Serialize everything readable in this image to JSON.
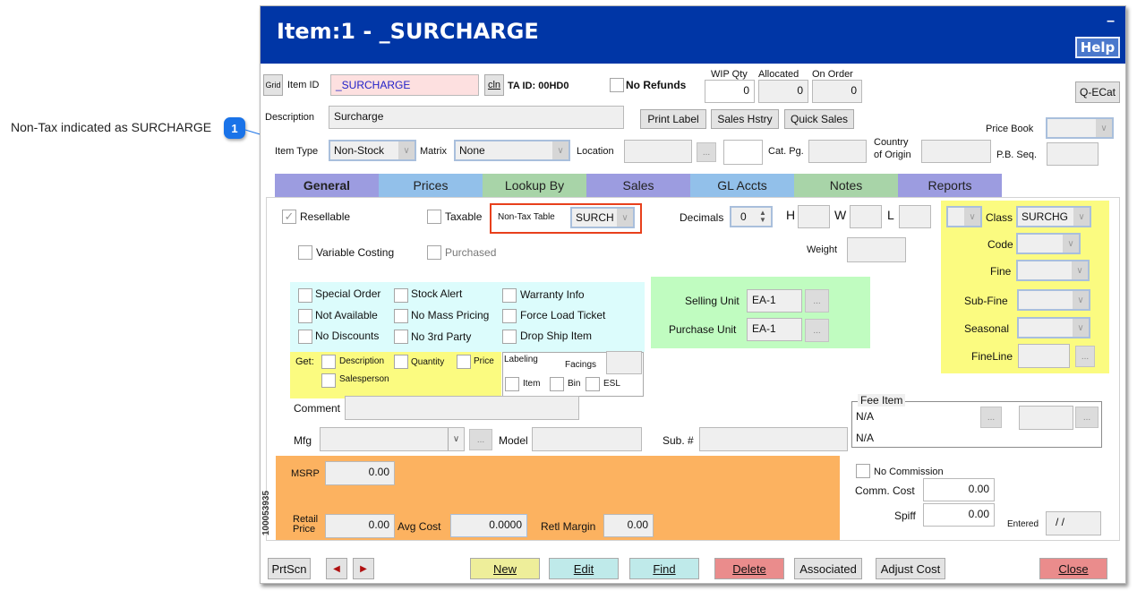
{
  "annotation": {
    "number": "1",
    "text": "Non-Tax indicated as SURCHARGE"
  },
  "window": {
    "title": "Item:1 - _SURCHARGE",
    "minimize": "–",
    "help_label": "Help"
  },
  "header": {
    "grid_label": "Grid",
    "item_id_label": "Item ID",
    "item_id_value": "_SURCHARGE",
    "cln_label": "cln",
    "ta_id": "TA ID: 00HD0",
    "no_refunds_label": "No Refunds",
    "no_refunds_checked": false,
    "wip_qty_label": "WIP Qty",
    "wip_qty_value": "0",
    "allocated_label": "Allocated",
    "allocated_value": "0",
    "on_order_label": "On Order",
    "on_order_value": "0",
    "qecat_label": "Q-ECat",
    "description_label": "Description",
    "description_value": "Surcharge",
    "print_label_btn": "Print Label",
    "sales_history_btn": "Sales Hstry",
    "quick_sales_btn": "Quick Sales",
    "price_book_label": "Price Book",
    "price_book_value": "",
    "item_type_label": "Item Type",
    "item_type_value": "Non-Stock",
    "matrix_label": "Matrix",
    "matrix_value": "None",
    "location_label": "Location",
    "location_value": "",
    "location_extra": "",
    "cat_pg_label": "Cat. Pg.",
    "cat_pg_value": "",
    "country_label_1": "Country",
    "country_label_2": "of Origin",
    "country_value": "",
    "pb_seq_label": "P.B. Seq.",
    "pb_seq_value": ""
  },
  "tabs": [
    {
      "label": "General",
      "active": true
    },
    {
      "label": "Prices",
      "active": false
    },
    {
      "label": "Lookup By",
      "active": false
    },
    {
      "label": "Sales",
      "active": false
    },
    {
      "label": "GL Accts",
      "active": false
    },
    {
      "label": "Notes",
      "active": false
    },
    {
      "label": "Reports",
      "active": false
    }
  ],
  "general": {
    "resellable_label": "Resellable",
    "resellable_checked": true,
    "taxable_label": "Taxable",
    "taxable_checked": false,
    "non_tax_table_label": "Non-Tax Table",
    "non_tax_table_value": "SURCH",
    "decimals_label": "Decimals",
    "decimals_value": "0",
    "h_label": "H",
    "w_label": "W",
    "l_label": "L",
    "weight_label": "Weight",
    "variable_costing_label": "Variable Costing",
    "purchased_label": "Purchased",
    "flags": [
      {
        "label": "Special Order",
        "checked": false
      },
      {
        "label": "Stock Alert",
        "checked": false
      },
      {
        "label": "Warranty Info",
        "checked": false
      },
      {
        "label": "Not Available",
        "checked": false
      },
      {
        "label": "No Mass Pricing",
        "checked": false
      },
      {
        "label": "Force Load Ticket",
        "checked": false
      },
      {
        "label": "No Discounts",
        "checked": false
      },
      {
        "label": "No 3rd Party",
        "checked": false
      },
      {
        "label": "Drop Ship Item",
        "checked": false
      }
    ],
    "get_label": "Get:",
    "get_options": [
      "Description",
      "Quantity",
      "Price",
      "Salesperson"
    ],
    "labeling_label": "Labeling",
    "facings_label": "Facings",
    "labeling_options": [
      "Item",
      "Bin",
      "ESL"
    ],
    "selling_unit_label": "Selling Unit",
    "selling_unit_value": "EA-1",
    "purchase_unit_label": "Purchase Unit",
    "purchase_unit_value": "EA-1",
    "class_label": "Class",
    "class_value": "SURCHG",
    "code_label": "Code",
    "fine_label": "Fine",
    "sub_fine_label": "Sub-Fine",
    "seasonal_label": "Seasonal",
    "fineline_label": "FineLine",
    "comment_label": "Comment",
    "comment_value": "",
    "mfg_label": "Mfg",
    "model_label": "Model",
    "sub_label": "Sub. #",
    "fee_item_legend": "Fee Item",
    "fee_item_line1": "N/A",
    "fee_item_line2": "N/A",
    "msrp_label": "MSRP",
    "msrp_value": "0.00",
    "retail_label_1": "Retail",
    "retail_label_2": "Price",
    "retail_value": "0.00",
    "avg_cost_label": "Avg Cost",
    "avg_cost_value": "0.0000",
    "retl_margin_label": "Retl Margin",
    "retl_margin_value": "0.00",
    "no_commission_label": "No Commission",
    "comm_cost_label": "Comm. Cost",
    "comm_cost_value": "0.00",
    "spiff_label": "Spiff",
    "spiff_value": "0.00",
    "entered_label": "Entered",
    "entered_value": "/ /",
    "side_id": "100053935"
  },
  "footer": {
    "prtscn": "PrtScn",
    "prev_icon": "◀",
    "next_icon": "▶",
    "new": "New",
    "edit": "Edit",
    "find": "Find",
    "delete": "Delete",
    "associated": "Associated",
    "adjust_cost": "Adjust Cost",
    "close": "Close"
  },
  "colors": {
    "titlebar": "#0036a6",
    "highlight": "#e8401c",
    "annotation": "#1a73e8"
  }
}
